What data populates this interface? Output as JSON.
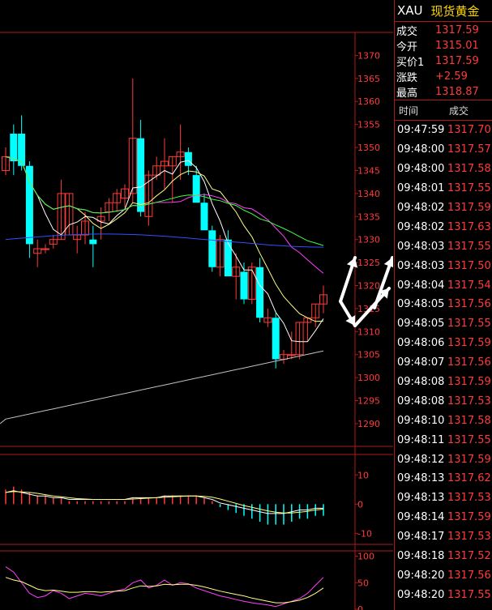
{
  "header": {
    "code": "XAU",
    "name": "现货黄金"
  },
  "quote": [
    {
      "label": "成交",
      "value": "1317.59"
    },
    {
      "label": "今开",
      "value": "1315.01"
    },
    {
      "label": "买价1",
      "value": "1317.59"
    },
    {
      "label": "涨跌",
      "value": "+2.59"
    },
    {
      "label": "最高",
      "value": "1318.87"
    }
  ],
  "ticks_header": {
    "time": "时间",
    "price": "成交"
  },
  "ticks": [
    {
      "time": "09:47:59",
      "price": "1317.70"
    },
    {
      "time": "09:48:00",
      "price": "1317.57"
    },
    {
      "time": "09:48:00",
      "price": "1317.58"
    },
    {
      "time": "09:48:01",
      "price": "1317.55"
    },
    {
      "time": "09:48:02",
      "price": "1317.59"
    },
    {
      "time": "09:48:02",
      "price": "1317.63"
    },
    {
      "time": "09:48:03",
      "price": "1317.55"
    },
    {
      "time": "09:48:03",
      "price": "1317.50"
    },
    {
      "time": "09:48:04",
      "price": "1317.54"
    },
    {
      "time": "09:48:05",
      "price": "1317.56"
    },
    {
      "time": "09:48:05",
      "price": "1317.55"
    },
    {
      "time": "09:48:06",
      "price": "1317.59"
    },
    {
      "time": "09:48:07",
      "price": "1317.56"
    },
    {
      "time": "09:48:08",
      "price": "1317.59"
    },
    {
      "time": "09:48:08",
      "price": "1317.53"
    },
    {
      "time": "09:48:10",
      "price": "1317.58"
    },
    {
      "time": "09:48:11",
      "price": "1317.55"
    },
    {
      "time": "09:48:12",
      "price": "1317.59"
    },
    {
      "time": "09:48:13",
      "price": "1317.62"
    },
    {
      "time": "09:48:13",
      "price": "1317.53"
    },
    {
      "time": "09:48:14",
      "price": "1317.59"
    },
    {
      "time": "09:48:17",
      "price": "1317.53"
    },
    {
      "time": "09:48:18",
      "price": "1317.52"
    },
    {
      "time": "09:48:20",
      "price": "1317.56"
    },
    {
      "time": "09:48:20",
      "price": "1317.55"
    }
  ],
  "colors": {
    "up": "#ff3b3b",
    "down": "#00ffff",
    "grid": "#b01818",
    "axis_text": "#ff3b3b",
    "ma1": "#ffffff",
    "ma2": "#ffff80",
    "ma3": "#ff40ff",
    "ma4": "#40ff40",
    "ma5": "#3050ff",
    "ma6": "#c0c0c0",
    "arrow": "#ffffff"
  },
  "chart_data": [
    {
      "type": "candlestick",
      "ylim": [
        1287,
        1375
      ],
      "y_ticks": [
        1370,
        1365,
        1360,
        1355,
        1350,
        1345,
        1340,
        1335,
        1330,
        1325,
        1320,
        1315,
        1310,
        1305,
        1300,
        1295,
        1290
      ],
      "candles": [
        [
          1345,
          1350,
          1344,
          1348
        ],
        [
          1353,
          1355,
          1344,
          1347
        ],
        [
          1353,
          1357,
          1345,
          1346
        ],
        [
          1346,
          1347,
          1326,
          1329
        ],
        [
          1327,
          1330,
          1324,
          1328
        ],
        [
          1328,
          1329,
          1327,
          1328
        ],
        [
          1329,
          1331,
          1328,
          1330
        ],
        [
          1330,
          1343,
          1330,
          1340
        ],
        [
          1331,
          1340,
          1331,
          1340
        ],
        [
          1330,
          1333,
          1327,
          1331
        ],
        [
          1331,
          1336,
          1329,
          1334
        ],
        [
          1330,
          1333,
          1324,
          1329
        ],
        [
          1334,
          1337,
          1330,
          1335
        ],
        [
          1336,
          1339,
          1334,
          1338
        ],
        [
          1338,
          1341,
          1336,
          1340
        ],
        [
          1339,
          1342,
          1337,
          1341
        ],
        [
          1340,
          1365,
          1338,
          1352
        ],
        [
          1352,
          1356,
          1335,
          1336
        ],
        [
          1335,
          1345,
          1333,
          1344
        ],
        [
          1344,
          1348,
          1343,
          1346
        ],
        [
          1346,
          1352,
          1341,
          1347
        ],
        [
          1346,
          1348,
          1338,
          1348
        ],
        [
          1348,
          1355,
          1343,
          1349
        ],
        [
          1349,
          1350,
          1344,
          1346
        ],
        [
          1344,
          1346,
          1338,
          1338
        ],
        [
          1338,
          1340,
          1333,
          1332
        ],
        [
          1332,
          1333,
          1323,
          1324
        ],
        [
          1324,
          1331,
          1322,
          1330
        ],
        [
          1330,
          1332,
          1322,
          1322
        ],
        [
          1322,
          1327,
          1317,
          1324
        ],
        [
          1323,
          1325,
          1316,
          1317
        ],
        [
          1317,
          1325,
          1316,
          1324
        ],
        [
          1324,
          1326,
          1312,
          1313
        ],
        [
          1312,
          1315,
          1311,
          1313
        ],
        [
          1313,
          1314,
          1302,
          1304
        ],
        [
          1304,
          1306,
          1303,
          1305
        ],
        [
          1305,
          1310,
          1304,
          1305
        ],
        [
          1305,
          1312,
          1304,
          1312
        ],
        [
          1312,
          1313,
          1308,
          1313
        ],
        [
          1313,
          1316,
          1311,
          1316
        ],
        [
          1316,
          1320,
          1314,
          1318
        ]
      ]
    },
    {
      "type": "bar",
      "ylim": [
        -11,
        17
      ],
      "y_ticks": [
        10,
        0,
        -10
      ],
      "values": [
        5,
        6,
        5,
        4,
        3,
        3,
        2,
        2,
        1,
        1,
        1,
        1,
        1,
        1,
        1,
        1,
        2,
        2,
        2,
        2,
        3,
        3,
        3,
        3,
        3,
        2,
        1,
        -1,
        -2,
        -3,
        -4,
        -5,
        -6,
        -7,
        -7,
        -7,
        -6,
        -5,
        -5,
        -4,
        -4
      ]
    },
    {
      "type": "line",
      "ylim": [
        0,
        110
      ],
      "y_ticks": [
        100,
        50,
        0
      ],
      "series": [
        {
          "values": [
            80,
            70,
            50,
            30,
            22,
            25,
            35,
            30,
            20,
            25,
            30,
            28,
            25,
            30,
            35,
            38,
            50,
            55,
            40,
            45,
            55,
            45,
            50,
            48,
            40,
            35,
            30,
            25,
            22,
            18,
            15,
            12,
            10,
            8,
            5,
            10,
            15,
            20,
            30,
            45,
            60
          ]
        },
        {
          "values": [
            60,
            55,
            52,
            45,
            38,
            35,
            36,
            34,
            32,
            32,
            33,
            33,
            32,
            33,
            34,
            35,
            40,
            44,
            43,
            44,
            47,
            46,
            47,
            47,
            45,
            42,
            38,
            34,
            31,
            28,
            25,
            21,
            18,
            15,
            12,
            12,
            14,
            17,
            22,
            30,
            40
          ]
        }
      ]
    }
  ]
}
